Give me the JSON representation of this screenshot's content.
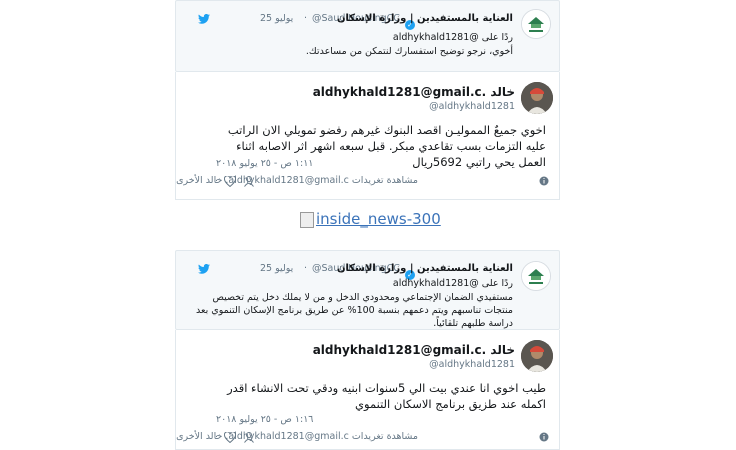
{
  "tweets": [
    {
      "reply": {
        "account_name": "العناية بالمستفيدين | وزارة الإسكان",
        "handle": "@SaudiHousingCC",
        "date": "25 يوليو",
        "replying_prefix": "ردًا على",
        "replying_to": "@aldhykhald1281",
        "text": "أخوي، نرجو توضيح استفسارك لنتمكن من مساعدتك."
      },
      "main": {
        "name": "aldhykhald1281@gmail.c. خالد",
        "handle": "@aldhykhald1281",
        "text": "اخوي جميعٌ المموليـن اقصد البنوك غيرهم رفضو تمويلي الان الراتب عليه التزمات بسب تقاعدي مبكر. قبل سبعه اشهر اثر الاصابه اثناء العمل يحي راتبي 5692ريال",
        "timestamp": "١:١١ ص - ٢٥ يوليو ٢٠١٨",
        "likes": "٠",
        "activity_link": "مشاهدة تغريدات aldhykhald1281@gmail.c. خالد الأخرى"
      }
    },
    {
      "reply": {
        "account_name": "العناية بالمستفيدين | وزارة الإسكان",
        "handle": "@SaudiHousingCC",
        "date": "25 يوليو",
        "replying_prefix": "ردًا على",
        "replying_to": "@aldhykhald1281",
        "text": "مستفيدي الضمان الإجتماعي ومحدودي الدخل و من لا يملك دخل يتم تخصيص منتجات تناسبهم ويتم دعمهم بنسبة 100% عن طريق برنامج الإسكان التنموي بعد دراسة طلبهم تلقائياً."
      },
      "main": {
        "name": "aldhykhald1281@gmail.c. خالد",
        "handle": "@aldhykhald1281",
        "text": "طيب اخوي انا عندي بيت الي 5سنوات ابنيه ودقي تحت الانشاء اقدر اكمله عند طزيق برنامج الاسكان التنموي",
        "timestamp": "١:١٦ ص - ٢٥ يوليو ٢٠١٨",
        "likes": "٠",
        "activity_link": "مشاهدة تغريدات aldhykhald1281@gmail.c. خالد الأخرى"
      }
    }
  ],
  "broken_image_alt": "inside_news-300",
  "colors": {
    "twitter_blue": "#1da1f2",
    "gray": "#657786",
    "link": "#3b73b9"
  }
}
